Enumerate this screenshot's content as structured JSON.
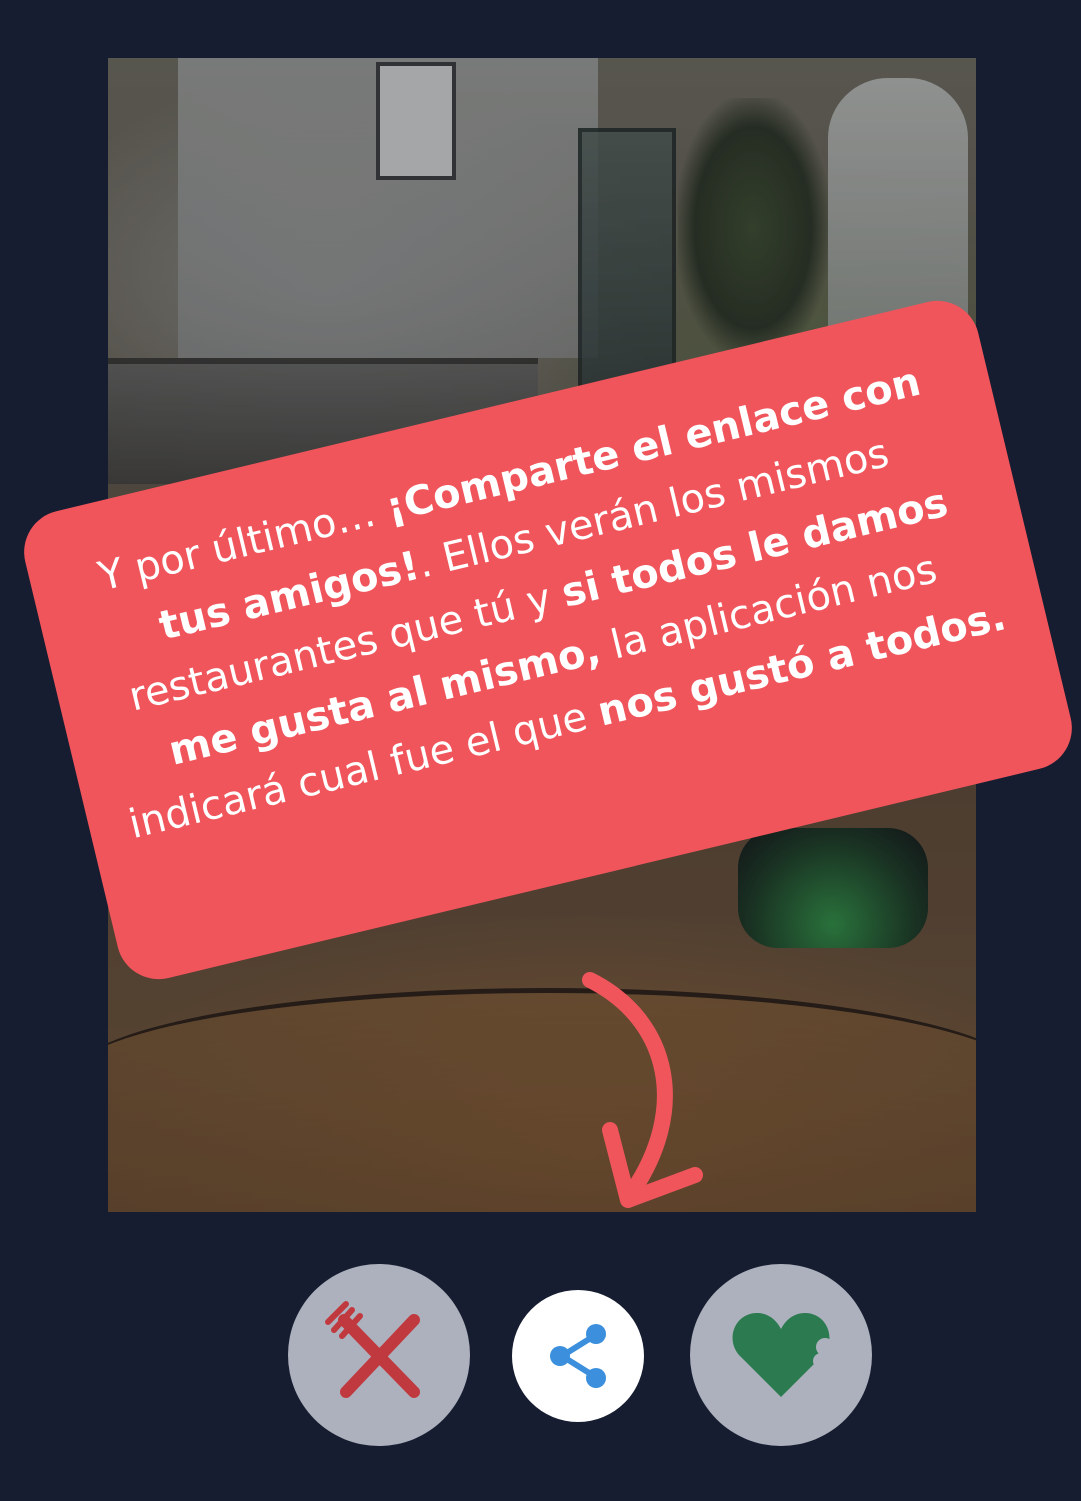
{
  "tutorial": {
    "intro": "Y por último… ",
    "highlight_share": "¡Comparte el enlace con tus amigos!",
    "period": ".",
    "sentence_1": " Ellos verán los mismos restaurantes que tú y ",
    "highlight_all_like": "si todos le damos me gusta al mismo,",
    "sentence_2": " la aplicación nos indicará cual fue el que ",
    "highlight_result": "nos gustó a todos."
  },
  "actions": {
    "dislike_icon": "fork-knife-cross-icon",
    "share_icon": "share-icon",
    "like_icon": "bitten-heart-icon"
  },
  "colors": {
    "background": "#161d30",
    "bubble": "#f0555c",
    "dislike": "#c0393f",
    "share": "#3b8fdc",
    "like": "#2b7a50",
    "button_bg": "#adb1bd"
  }
}
